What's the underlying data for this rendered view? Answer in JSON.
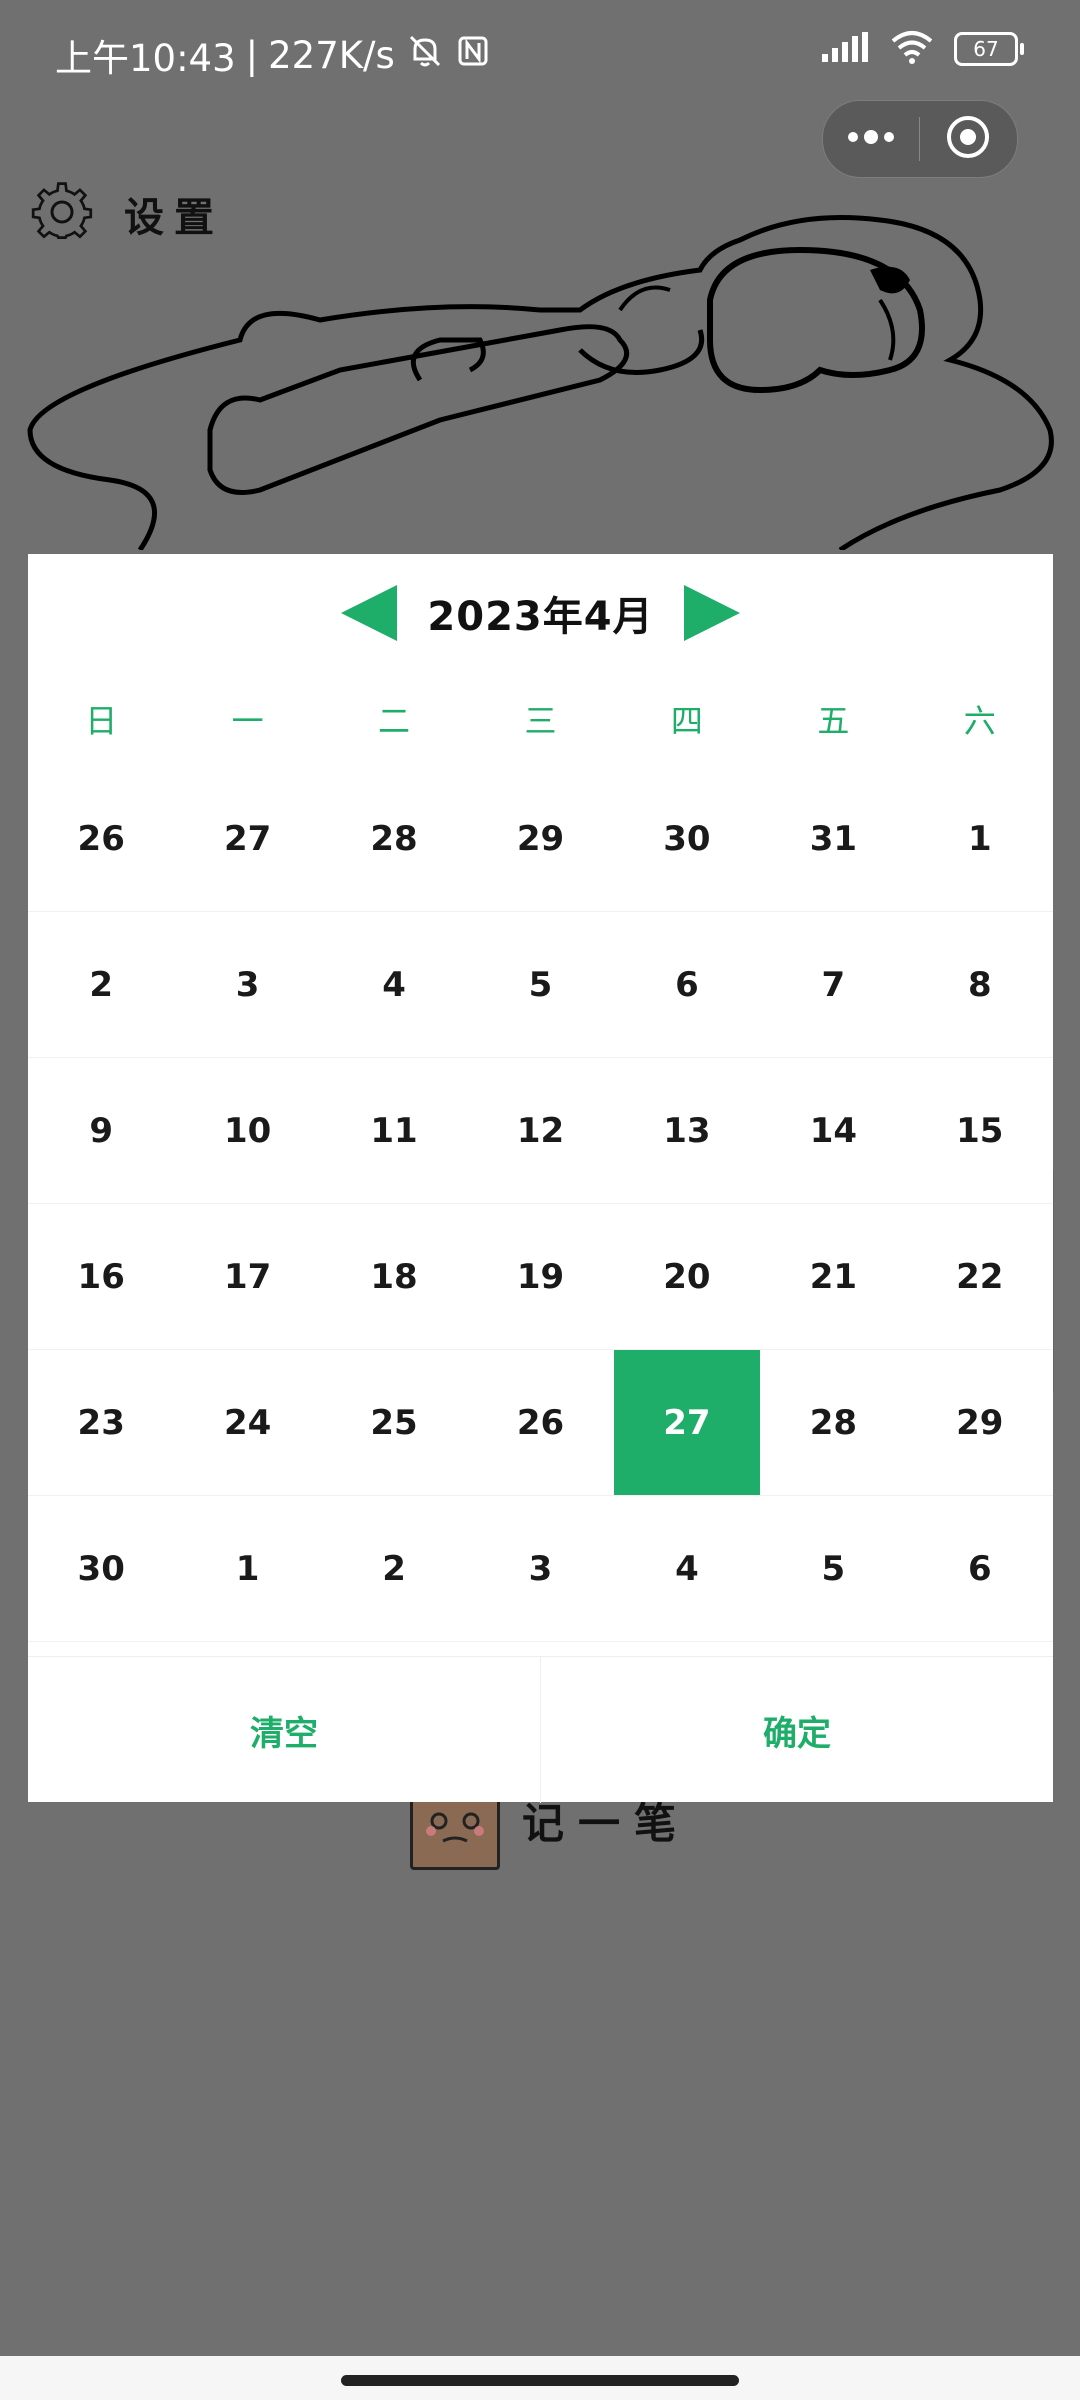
{
  "status_bar": {
    "time": "上午10:43",
    "speed": "227K/s",
    "battery": "67",
    "icons": [
      "mute-bell-icon",
      "nfc-icon",
      "signal-icon",
      "wifi-icon",
      "battery-icon"
    ]
  },
  "capsule": {
    "icons": [
      "more-dots-icon",
      "close-target-icon"
    ]
  },
  "page": {
    "settings_label": "设置",
    "record_label": "记一笔"
  },
  "calendar": {
    "month_title": "2023年4月",
    "weekdays": [
      "日",
      "一",
      "二",
      "三",
      "四",
      "五",
      "六"
    ],
    "days": [
      "26",
      "27",
      "28",
      "29",
      "30",
      "31",
      "1",
      "2",
      "3",
      "4",
      "5",
      "6",
      "7",
      "8",
      "9",
      "10",
      "11",
      "12",
      "13",
      "14",
      "15",
      "16",
      "17",
      "18",
      "19",
      "20",
      "21",
      "22",
      "23",
      "24",
      "25",
      "26",
      "27",
      "28",
      "29",
      "30",
      "1",
      "2",
      "3",
      "4",
      "5",
      "6"
    ],
    "selected_day": "27",
    "clear_label": "清空",
    "confirm_label": "确定"
  },
  "colors": {
    "accent": "#1fad6a",
    "overlay": "#707070",
    "text": "#1a1a1a"
  }
}
